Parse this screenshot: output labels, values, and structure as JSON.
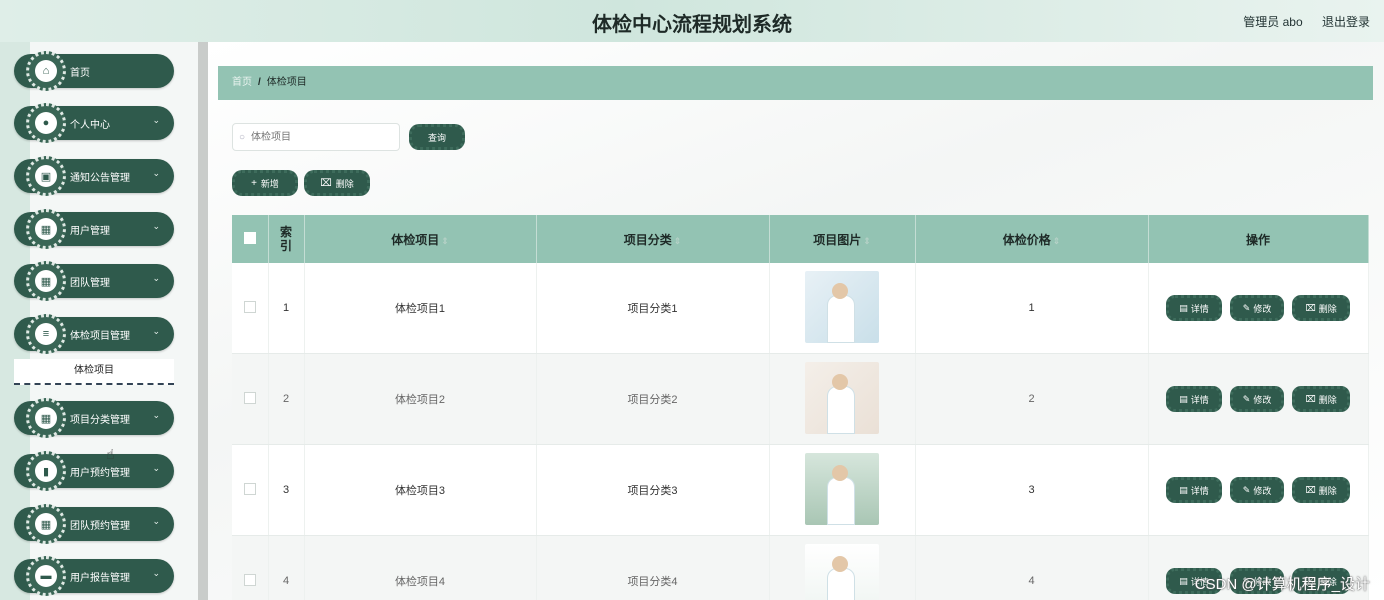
{
  "header": {
    "title": "体检中心流程规划系统",
    "user": "管理员 abo",
    "logout": "退出登录"
  },
  "sidebar": {
    "items": [
      {
        "label": "首页",
        "icon": "home-icon",
        "glyph": "⌂",
        "chevron": false
      },
      {
        "label": "个人中心",
        "icon": "user-icon",
        "glyph": "●",
        "chevron": true
      },
      {
        "label": "通知公告管理",
        "icon": "notice-icon",
        "glyph": "▣",
        "chevron": true
      },
      {
        "label": "用户管理",
        "icon": "grid-icon",
        "glyph": "▦",
        "chevron": true
      },
      {
        "label": "团队管理",
        "icon": "grid-icon",
        "glyph": "▦",
        "chevron": true
      },
      {
        "label": "体检项目管理",
        "icon": "sliders-icon",
        "glyph": "≡",
        "chevron": true
      },
      {
        "label": "项目分类管理",
        "icon": "grid-icon",
        "glyph": "▦",
        "chevron": true
      },
      {
        "label": "用户预约管理",
        "icon": "bar-chart-icon",
        "glyph": "▮",
        "chevron": true
      },
      {
        "label": "团队预约管理",
        "icon": "grid-icon",
        "glyph": "▦",
        "chevron": true
      },
      {
        "label": "用户报告管理",
        "icon": "monitor-icon",
        "glyph": "▬",
        "chevron": true
      }
    ],
    "submenu": "体检项目"
  },
  "breadcrumb": {
    "home": "首页",
    "separator": "/",
    "current": "体检项目"
  },
  "search": {
    "placeholder": "体检项目",
    "query_button": "查询"
  },
  "toolbar": {
    "add_label": "新增",
    "delete_label": "删除"
  },
  "table": {
    "headers": {
      "index": "索引",
      "item": "体检项目",
      "category": "项目分类",
      "image": "项目图片",
      "price": "体检价格",
      "actions": "操作"
    },
    "rows": [
      {
        "index": "1",
        "item": "体检项目1",
        "category": "项目分类1",
        "price": "1"
      },
      {
        "index": "2",
        "item": "体检项目2",
        "category": "项目分类2",
        "price": "2"
      },
      {
        "index": "3",
        "item": "体检项目3",
        "category": "项目分类3",
        "price": "3"
      },
      {
        "index": "4",
        "item": "体检项目4",
        "category": "项目分类4",
        "price": "4"
      }
    ],
    "actions": {
      "detail": "详情",
      "edit": "修改",
      "delete": "删除"
    }
  },
  "watermark": "CSDN @计算机程序_设计",
  "colors": {
    "primary": "#2f5a4c",
    "header_bg": "#93c3b3",
    "breadcrumb_bg": "#93c3b3"
  }
}
